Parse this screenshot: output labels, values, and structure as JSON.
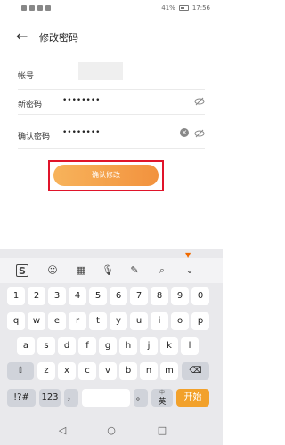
{
  "statusbar": {
    "battery_text": "41%",
    "time": "17:56"
  },
  "header": {
    "title": "修改密码"
  },
  "form": {
    "account_label": "帐号",
    "new_password_label": "新密码",
    "new_password_value": "••••••••",
    "confirm_password_label": "确认密码",
    "confirm_password_value": "••••••••"
  },
  "confirm_button": {
    "label": "确认修改"
  },
  "keyboard": {
    "numbers": [
      "1",
      "2",
      "3",
      "4",
      "5",
      "6",
      "7",
      "8",
      "9",
      "0"
    ],
    "row1": [
      "q",
      "w",
      "e",
      "r",
      "t",
      "y",
      "u",
      "i",
      "o",
      "p"
    ],
    "row2": [
      "a",
      "s",
      "d",
      "f",
      "g",
      "h",
      "j",
      "k",
      "l"
    ],
    "row3": [
      "z",
      "x",
      "c",
      "v",
      "b",
      "n",
      "m"
    ],
    "symbols_label": "!?#",
    "num_label": "123",
    "comma_label": "，",
    "period_label": "。",
    "lang_label": "英",
    "lang_top": "中",
    "go_label": "开始"
  }
}
